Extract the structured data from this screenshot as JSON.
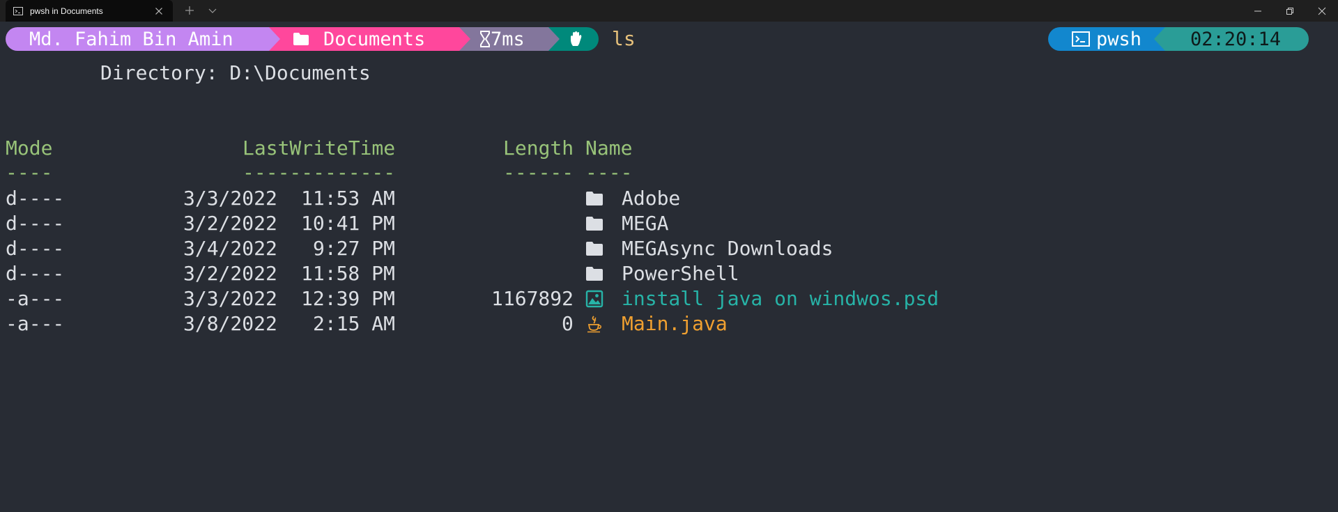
{
  "tab": {
    "title": "pwsh in Documents",
    "icon": "terminal-icon"
  },
  "prompt": {
    "user": "Md. Fahim Bin Amin",
    "folder": "Documents",
    "exec_time": "7ms",
    "command": "ls",
    "shell": "pwsh",
    "clock": "02:20:14"
  },
  "listing": {
    "directory": "Directory: D:\\Documents",
    "headers": {
      "mode": "Mode",
      "time": "LastWriteTime",
      "length": "Length",
      "name": "Name"
    },
    "underlines": {
      "mode": "----",
      "time": "-------------",
      "length": "------",
      "name": "----"
    },
    "rows": [
      {
        "mode": "d----",
        "date": "3/3/2022",
        "time": "11:53 AM",
        "length": "",
        "name": "Adobe",
        "type": "folder"
      },
      {
        "mode": "d----",
        "date": "3/2/2022",
        "time": "10:41 PM",
        "length": "",
        "name": "MEGA",
        "type": "folder"
      },
      {
        "mode": "d----",
        "date": "3/4/2022",
        "time": "9:27 PM",
        "length": "",
        "name": "MEGAsync Downloads",
        "type": "folder"
      },
      {
        "mode": "d----",
        "date": "3/2/2022",
        "time": "11:58 PM",
        "length": "",
        "name": "PowerShell",
        "type": "folder"
      },
      {
        "mode": "-a---",
        "date": "3/3/2022",
        "time": "12:39 PM",
        "length": "1167892",
        "name": "install java on windwos.psd",
        "type": "image"
      },
      {
        "mode": "-a---",
        "date": "3/8/2022",
        "time": "2:15 AM",
        "length": "0",
        "name": "Main.java",
        "type": "java"
      }
    ]
  },
  "colors": {
    "background": "#282c34",
    "user_segment": "#c386f1",
    "folder_segment": "#ff479c",
    "time_segment": "#83769c",
    "status_segment": "#00897b",
    "shell_segment": "#1287ce",
    "clock_segment": "#2a9d97",
    "header_green": "#98c379",
    "command_yellow": "#e5c07b",
    "image_teal": "#27b3a7",
    "java_orange": "#f0a030"
  }
}
